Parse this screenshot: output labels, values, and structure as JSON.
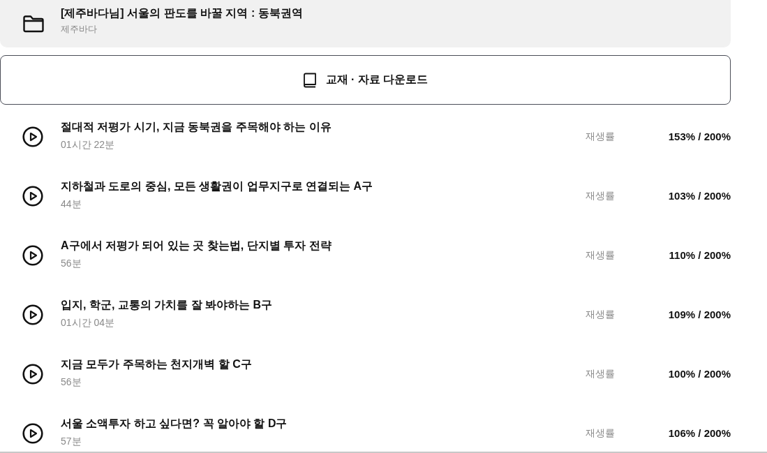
{
  "course": {
    "title": "[제주바다님] 서울의 판도를 바꿀 지역 : 동북권역",
    "author": "제주바다"
  },
  "download_button": {
    "label": "교재 · 자료 다운로드"
  },
  "lectures": [
    {
      "title": "절대적 저평가 시기, 지금 동북권을 주목해야 하는 이유",
      "duration": "01시간 22분",
      "progress_label": "재생률",
      "progress": "153% / 200%"
    },
    {
      "title": "지하철과 도로의 중심, 모든 생활권이 업무지구로 연결되는 A구",
      "duration": "44분",
      "progress_label": "재생률",
      "progress": "103% / 200%"
    },
    {
      "title": "A구에서 저평가 되어 있는 곳 찾는법, 단지별 투자 전략",
      "duration": "56분",
      "progress_label": "재생률",
      "progress": "110% / 200%"
    },
    {
      "title": "입지, 학군, 교통의 가치를 잘 봐야하는 B구",
      "duration": "01시간 04분",
      "progress_label": "재생률",
      "progress": "109% / 200%"
    },
    {
      "title": "지금 모두가 주목하는 천지개벽 할 C구",
      "duration": "56분",
      "progress_label": "재생률",
      "progress": "100% / 200%"
    },
    {
      "title": "서울 소액투자 하고 싶다면? 꼭 알아야 할 D구",
      "duration": "57분",
      "progress_label": "재생률",
      "progress": "106% / 200%"
    }
  ]
}
